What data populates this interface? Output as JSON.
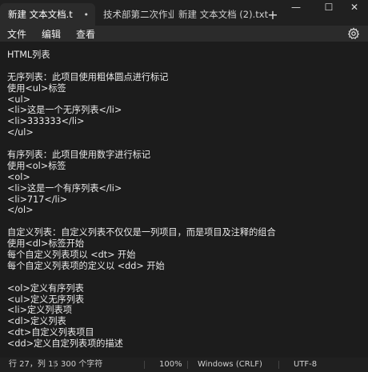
{
  "tabs": [
    {
      "label": "新建 文本文档.t",
      "active": true,
      "close": "•"
    },
    {
      "label": "技术部第二次作业.htn",
      "active": false
    },
    {
      "label": "新建 文本文档 (2).txt",
      "active": false
    }
  ],
  "new_tab_symbol": "+",
  "window_controls": {
    "minimize": "—",
    "maximize": "☐",
    "close": "✕"
  },
  "menu": [
    "文件",
    "编辑",
    "查看"
  ],
  "settings_icon": "gear-icon",
  "editor_lines": [
    "HTML列表",
    "",
    "无序列表：此项目使用粗体圆点进行标记",
    "使用<ul>标签",
    "<ul>",
    "<li>这是一个无序列表</li>",
    "<li>333333</li>",
    "</ul>",
    "",
    "有序列表：此项目使用数字进行标记",
    "使用<ol>标签",
    "<ol>",
    "<li>这是一个有序列表</li>",
    "<li>717</li>",
    "</ol>",
    "",
    "自定义列表：自定义列表不仅仅是一列项目，而是项目及注释的组合",
    "使用<dl>标签开始",
    "每个自定义列表项以 <dt> 开始",
    "每个自定义列表项的定义以 <dd> 开始",
    "",
    "<ol>定义有序列表",
    "<ul>定义无序列表",
    "<li>定义列表项",
    "<dl>定义列表",
    "<dt>自定义列表项目",
    "<dd>定义自定列表项的描述"
  ],
  "status": {
    "position": "行 27，列 15",
    "char_count": "300 个字符",
    "zoom": "100%",
    "line_ending": "Windows (CRLF)",
    "encoding": "UTF-8"
  }
}
